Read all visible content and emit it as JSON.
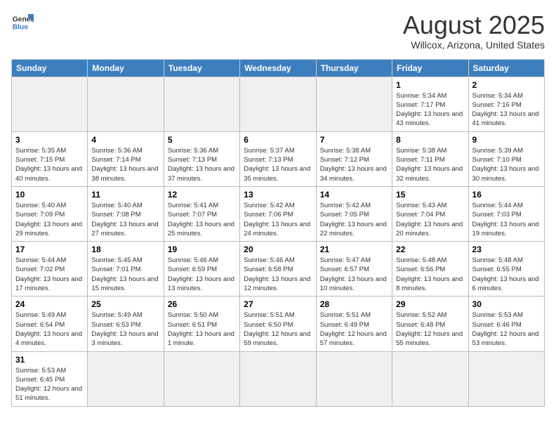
{
  "header": {
    "logo_general": "General",
    "logo_blue": "Blue",
    "title": "August 2025",
    "subtitle": "Willcox, Arizona, United States"
  },
  "days_of_week": [
    "Sunday",
    "Monday",
    "Tuesday",
    "Wednesday",
    "Thursday",
    "Friday",
    "Saturday"
  ],
  "weeks": [
    [
      {
        "day": "",
        "info": ""
      },
      {
        "day": "",
        "info": ""
      },
      {
        "day": "",
        "info": ""
      },
      {
        "day": "",
        "info": ""
      },
      {
        "day": "",
        "info": ""
      },
      {
        "day": "1",
        "info": "Sunrise: 5:34 AM\nSunset: 7:17 PM\nDaylight: 13 hours and 43 minutes."
      },
      {
        "day": "2",
        "info": "Sunrise: 5:34 AM\nSunset: 7:16 PM\nDaylight: 13 hours and 41 minutes."
      }
    ],
    [
      {
        "day": "3",
        "info": "Sunrise: 5:35 AM\nSunset: 7:15 PM\nDaylight: 13 hours and 40 minutes."
      },
      {
        "day": "4",
        "info": "Sunrise: 5:36 AM\nSunset: 7:14 PM\nDaylight: 13 hours and 38 minutes."
      },
      {
        "day": "5",
        "info": "Sunrise: 5:36 AM\nSunset: 7:13 PM\nDaylight: 13 hours and 37 minutes."
      },
      {
        "day": "6",
        "info": "Sunrise: 5:37 AM\nSunset: 7:13 PM\nDaylight: 13 hours and 35 minutes."
      },
      {
        "day": "7",
        "info": "Sunrise: 5:38 AM\nSunset: 7:12 PM\nDaylight: 13 hours and 34 minutes."
      },
      {
        "day": "8",
        "info": "Sunrise: 5:38 AM\nSunset: 7:11 PM\nDaylight: 13 hours and 32 minutes."
      },
      {
        "day": "9",
        "info": "Sunrise: 5:39 AM\nSunset: 7:10 PM\nDaylight: 13 hours and 30 minutes."
      }
    ],
    [
      {
        "day": "10",
        "info": "Sunrise: 5:40 AM\nSunset: 7:09 PM\nDaylight: 13 hours and 29 minutes."
      },
      {
        "day": "11",
        "info": "Sunrise: 5:40 AM\nSunset: 7:08 PM\nDaylight: 13 hours and 27 minutes."
      },
      {
        "day": "12",
        "info": "Sunrise: 5:41 AM\nSunset: 7:07 PM\nDaylight: 13 hours and 25 minutes."
      },
      {
        "day": "13",
        "info": "Sunrise: 5:42 AM\nSunset: 7:06 PM\nDaylight: 13 hours and 24 minutes."
      },
      {
        "day": "14",
        "info": "Sunrise: 5:42 AM\nSunset: 7:05 PM\nDaylight: 13 hours and 22 minutes."
      },
      {
        "day": "15",
        "info": "Sunrise: 5:43 AM\nSunset: 7:04 PM\nDaylight: 13 hours and 20 minutes."
      },
      {
        "day": "16",
        "info": "Sunrise: 5:44 AM\nSunset: 7:03 PM\nDaylight: 13 hours and 19 minutes."
      }
    ],
    [
      {
        "day": "17",
        "info": "Sunrise: 5:44 AM\nSunset: 7:02 PM\nDaylight: 13 hours and 17 minutes."
      },
      {
        "day": "18",
        "info": "Sunrise: 5:45 AM\nSunset: 7:01 PM\nDaylight: 13 hours and 15 minutes."
      },
      {
        "day": "19",
        "info": "Sunrise: 5:46 AM\nSunset: 6:59 PM\nDaylight: 13 hours and 13 minutes."
      },
      {
        "day": "20",
        "info": "Sunrise: 5:46 AM\nSunset: 6:58 PM\nDaylight: 13 hours and 12 minutes."
      },
      {
        "day": "21",
        "info": "Sunrise: 5:47 AM\nSunset: 6:57 PM\nDaylight: 13 hours and 10 minutes."
      },
      {
        "day": "22",
        "info": "Sunrise: 5:48 AM\nSunset: 6:56 PM\nDaylight: 13 hours and 8 minutes."
      },
      {
        "day": "23",
        "info": "Sunrise: 5:48 AM\nSunset: 6:55 PM\nDaylight: 13 hours and 6 minutes."
      }
    ],
    [
      {
        "day": "24",
        "info": "Sunrise: 5:49 AM\nSunset: 6:54 PM\nDaylight: 13 hours and 4 minutes."
      },
      {
        "day": "25",
        "info": "Sunrise: 5:49 AM\nSunset: 6:53 PM\nDaylight: 13 hours and 3 minutes."
      },
      {
        "day": "26",
        "info": "Sunrise: 5:50 AM\nSunset: 6:51 PM\nDaylight: 13 hours and 1 minute."
      },
      {
        "day": "27",
        "info": "Sunrise: 5:51 AM\nSunset: 6:50 PM\nDaylight: 12 hours and 59 minutes."
      },
      {
        "day": "28",
        "info": "Sunrise: 5:51 AM\nSunset: 6:49 PM\nDaylight: 12 hours and 57 minutes."
      },
      {
        "day": "29",
        "info": "Sunrise: 5:52 AM\nSunset: 6:48 PM\nDaylight: 12 hours and 55 minutes."
      },
      {
        "day": "30",
        "info": "Sunrise: 5:53 AM\nSunset: 6:46 PM\nDaylight: 12 hours and 53 minutes."
      }
    ],
    [
      {
        "day": "31",
        "info": "Sunrise: 5:53 AM\nSunset: 6:45 PM\nDaylight: 12 hours and 51 minutes."
      },
      {
        "day": "",
        "info": ""
      },
      {
        "day": "",
        "info": ""
      },
      {
        "day": "",
        "info": ""
      },
      {
        "day": "",
        "info": ""
      },
      {
        "day": "",
        "info": ""
      },
      {
        "day": "",
        "info": ""
      }
    ]
  ],
  "empty_weeks_first_row_empty_cols": [
    0,
    1,
    2,
    3,
    4
  ],
  "last_week_empty_cols": [
    1,
    2,
    3,
    4,
    5,
    6
  ]
}
